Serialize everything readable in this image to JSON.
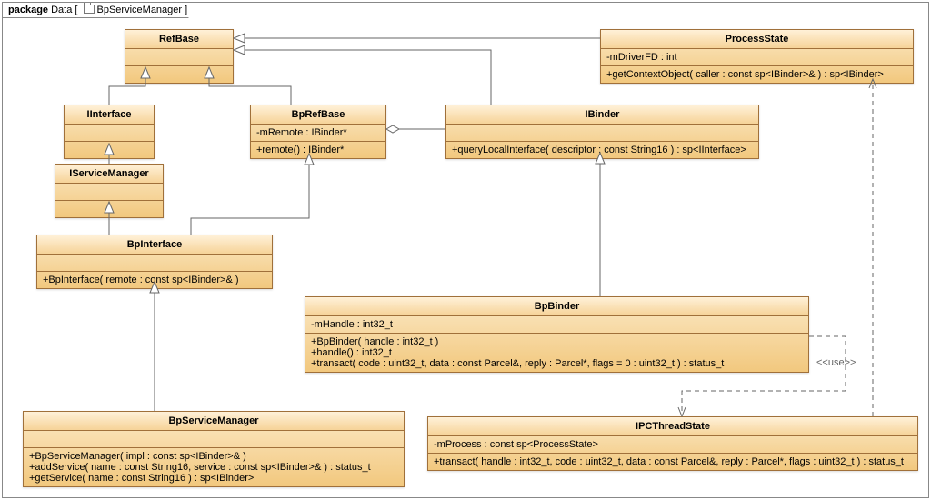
{
  "package": {
    "keyword": "package",
    "name": "Data",
    "ref": "BpServiceManager"
  },
  "classes": {
    "RefBase": {
      "name": "RefBase"
    },
    "ProcessState": {
      "name": "ProcessState",
      "attr1": "-mDriverFD : int",
      "op1": "+getContextObject( caller : const sp<IBinder>& ) : sp<IBinder>"
    },
    "IInterface": {
      "name": "IInterface"
    },
    "IServiceManager": {
      "name": "IServiceManager"
    },
    "BpRefBase": {
      "name": "BpRefBase",
      "attr1": "-mRemote : IBinder*",
      "op1": "+remote() : IBinder*"
    },
    "IBinder": {
      "name": "IBinder",
      "op1": "+queryLocalInterface( descriptor : const String16 ) : sp<IInterface>"
    },
    "BpInterface": {
      "name": "BpInterface",
      "op1": "+BpInterface( remote : const sp<IBinder>& )"
    },
    "BpBinder": {
      "name": "BpBinder",
      "attr1": "-mHandle : int32_t",
      "op1": "+BpBinder( handle : int32_t )",
      "op2": "+handle() : int32_t",
      "op3": "+transact( code : uint32_t, data : const Parcel&, reply : Parcel*, flags = 0 : uint32_t ) : status_t"
    },
    "BpServiceManager": {
      "name": "BpServiceManager",
      "op1": "+BpServiceManager( impl : const sp<IBinder>& )",
      "op2": "+addService( name : const String16, service : const sp<IBinder>& ) : status_t",
      "op3": "+getService( name : const String16 ) : sp<IBinder>"
    },
    "IPCThreadState": {
      "name": "IPCThreadState",
      "attr1": "-mProcess : const sp<ProcessState>",
      "op1": "+transact( handle : int32_t, code : uint32_t, data : const Parcel&, reply : Parcel*, flags : uint32_t ) : status_t"
    }
  },
  "stereotypes": {
    "use": "<<use>>"
  },
  "chart_data": {
    "type": "table",
    "diagram_kind": "UML class diagram",
    "package": "Data",
    "classes": [
      {
        "name": "RefBase",
        "attributes": [],
        "operations": []
      },
      {
        "name": "ProcessState",
        "attributes": [
          "-mDriverFD : int"
        ],
        "operations": [
          "+getContextObject( caller : const sp<IBinder>& ) : sp<IBinder>"
        ]
      },
      {
        "name": "IInterface",
        "attributes": [],
        "operations": []
      },
      {
        "name": "IServiceManager",
        "attributes": [],
        "operations": []
      },
      {
        "name": "BpRefBase",
        "attributes": [
          "-mRemote : IBinder*"
        ],
        "operations": [
          "+remote() : IBinder*"
        ]
      },
      {
        "name": "IBinder",
        "attributes": [],
        "operations": [
          "+queryLocalInterface( descriptor : const String16 ) : sp<IInterface>"
        ]
      },
      {
        "name": "BpInterface",
        "attributes": [],
        "operations": [
          "+BpInterface( remote : const sp<IBinder>& )"
        ]
      },
      {
        "name": "BpBinder",
        "attributes": [
          "-mHandle : int32_t"
        ],
        "operations": [
          "+BpBinder( handle : int32_t )",
          "+handle() : int32_t",
          "+transact( code : uint32_t, data : const Parcel&, reply : Parcel*, flags = 0 : uint32_t ) : status_t"
        ]
      },
      {
        "name": "BpServiceManager",
        "attributes": [],
        "operations": [
          "+BpServiceManager( impl : const sp<IBinder>& )",
          "+addService( name : const String16, service : const sp<IBinder>& ) : status_t",
          "+getService( name : const String16 ) : sp<IBinder>"
        ]
      },
      {
        "name": "IPCThreadState",
        "attributes": [
          "-mProcess : const sp<ProcessState>"
        ],
        "operations": [
          "+transact( handle : int32_t, code : uint32_t, data : const Parcel&, reply : Parcel*, flags : uint32_t ) : status_t"
        ]
      }
    ],
    "relationships": [
      {
        "from": "IInterface",
        "to": "RefBase",
        "type": "generalization"
      },
      {
        "from": "BpRefBase",
        "to": "RefBase",
        "type": "generalization"
      },
      {
        "from": "IBinder",
        "to": "RefBase",
        "type": "generalization"
      },
      {
        "from": "ProcessState",
        "to": "RefBase",
        "type": "generalization"
      },
      {
        "from": "IServiceManager",
        "to": "IInterface",
        "type": "generalization"
      },
      {
        "from": "BpInterface",
        "to": "IServiceManager",
        "type": "generalization"
      },
      {
        "from": "BpInterface",
        "to": "BpRefBase",
        "type": "generalization"
      },
      {
        "from": "BpBinder",
        "to": "IBinder",
        "type": "generalization"
      },
      {
        "from": "BpServiceManager",
        "to": "BpInterface",
        "type": "generalization"
      },
      {
        "from": "BpRefBase",
        "to": "IBinder",
        "type": "aggregation"
      },
      {
        "from": "BpBinder",
        "to": "IPCThreadState",
        "type": "dependency",
        "stereotype": "use"
      },
      {
        "from": "IPCThreadState",
        "to": "ProcessState",
        "type": "dependency",
        "stereotype": "use"
      }
    ]
  }
}
